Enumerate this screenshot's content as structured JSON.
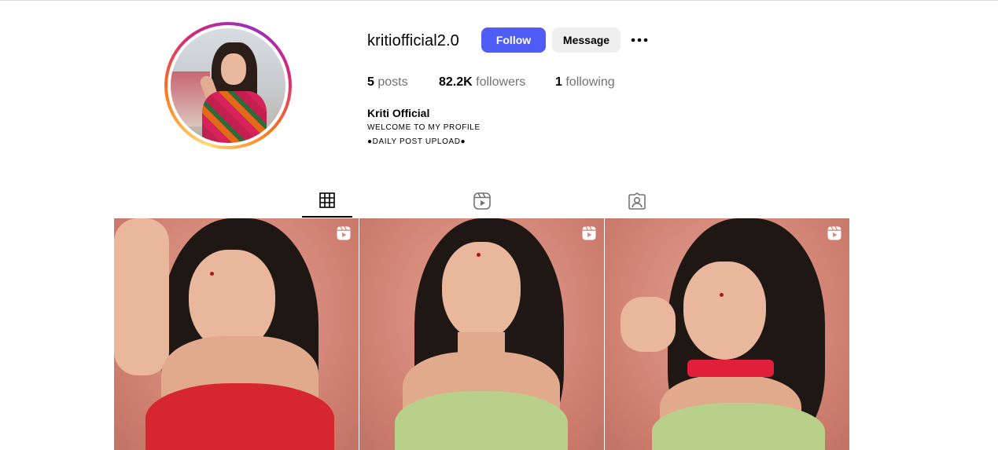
{
  "profile": {
    "username": "kritiofficial2.0",
    "follow_label": "Follow",
    "message_label": "Message",
    "more_icon": "more-horizontal-icon",
    "stats": {
      "posts_count": "5",
      "posts_label": "posts",
      "followers_count": "82.2K",
      "followers_label": "followers",
      "following_count": "1",
      "following_label": "following"
    },
    "full_name": "Kriti Official",
    "bio_lines": [
      "WELCOME TO MY PROFILE",
      "●DAILY POST UPLOAD●"
    ]
  },
  "tabs": [
    {
      "name": "posts",
      "icon": "grid-icon",
      "active": true
    },
    {
      "name": "reels",
      "icon": "reels-icon",
      "active": false
    },
    {
      "name": "tagged",
      "icon": "tagged-icon",
      "active": false
    }
  ],
  "posts": [
    {
      "type": "reel",
      "badge_icon": "reel-icon",
      "top_color": "#d6262f"
    },
    {
      "type": "reel",
      "badge_icon": "reel-icon",
      "top_color": "#b8d08a"
    },
    {
      "type": "reel",
      "badge_icon": "reel-icon",
      "top_color": "#b8d08a"
    }
  ],
  "colors": {
    "follow_button": "#4f5cf5",
    "message_button": "#efefef",
    "muted_text": "#737373"
  }
}
